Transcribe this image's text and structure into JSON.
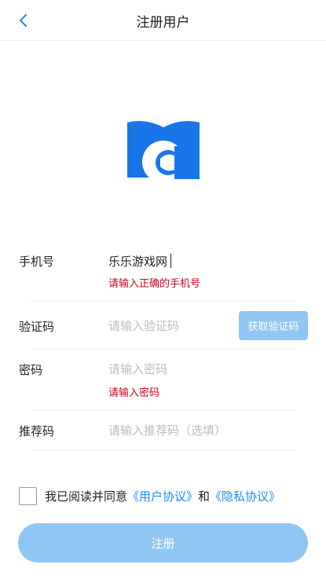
{
  "header": {
    "title": "注册用户",
    "back_icon": "chevron-left-icon"
  },
  "logo": {
    "icon": "book-c-logo",
    "color": "#1976e8"
  },
  "form": {
    "phone": {
      "label": "手机号",
      "value": "乐乐游戏网",
      "error": "请输入正确的手机号"
    },
    "code": {
      "label": "验证码",
      "placeholder": "请输入验证码",
      "button_label": "获取验证码"
    },
    "password": {
      "label": "密码",
      "placeholder": "请输入密码",
      "error": "请输入密码"
    },
    "referral": {
      "label": "推荐码",
      "placeholder": "请输入推荐码（选填）"
    }
  },
  "agreement": {
    "checked": false,
    "prefix": "我已阅读并同意",
    "user_agreement": "《用户协议》",
    "conjunction": "和",
    "privacy_policy": "《隐私协议》"
  },
  "submit": {
    "label": "注册"
  },
  "colors": {
    "accent": "#1a8cff",
    "button_disabled": "#90c6f4",
    "error": "#d0021b",
    "placeholder": "#bdbdbd"
  }
}
